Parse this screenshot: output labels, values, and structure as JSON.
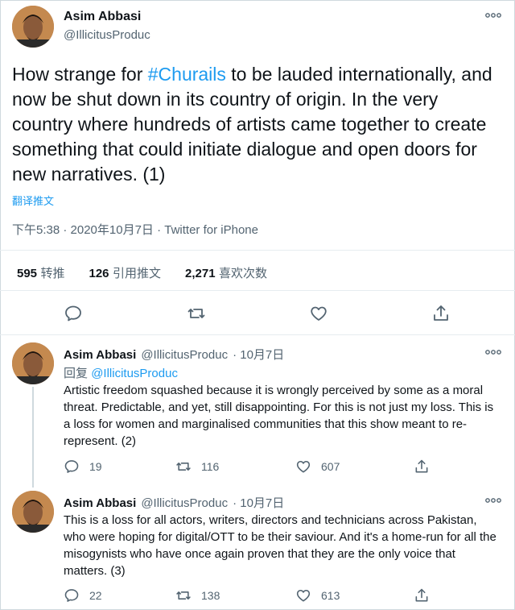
{
  "main_tweet": {
    "author_name": "Asim Abbasi",
    "author_handle": "@IllicitusProduc",
    "text_before_tag": "How strange for ",
    "hashtag": "#Churails",
    "text_after_tag": " to be lauded internationally, and now be shut down in its country of origin. In the very country where hundreds of artists came together to create something that could initiate dialogue and open doors for new narratives. (1)",
    "translate_label": "翻译推文",
    "timestamp": "下午5:38 · 2020年10月7日 · Twitter for iPhone",
    "stats": {
      "retweets_count": "595",
      "retweets_label": "转推",
      "quotes_count": "126",
      "quotes_label": "引用推文",
      "likes_count": "2,271",
      "likes_label": "喜欢次数"
    }
  },
  "replies": [
    {
      "author_name": "Asim Abbasi",
      "author_handle": "@IllicitusProduc",
      "date": "· 10月7日",
      "reply_prefix": "回复",
      "reply_to": "@IllicitusProduc",
      "text": "Artistic freedom squashed because it is wrongly perceived by some as a moral threat. Predictable, and yet, still disappointing. For this is not just my loss. This is a loss for women and marginalised communities that this show meant to re-represent. (2)",
      "replies_count": "19",
      "retweets_count": "116",
      "likes_count": "607"
    },
    {
      "author_name": "Asim Abbasi",
      "author_handle": "@IllicitusProduc",
      "date": "· 10月7日",
      "text": "This is a loss for all actors, writers, directors and technicians across Pakistan, who were hoping for digital/OTT to be their saviour. And it's a home-run for all the misogynists who have once again proven that they are the only voice that matters. (3)",
      "replies_count": "22",
      "retweets_count": "138",
      "likes_count": "613"
    }
  ],
  "icons": {
    "reply": "speech-bubble-icon",
    "retweet": "retweet-icon",
    "like": "heart-icon",
    "share": "share-icon",
    "more": "more-dots-icon"
  },
  "colors": {
    "accent": "#1d9bf0",
    "text": "#0f1419",
    "secondary": "#536471",
    "border": "#e6ecf0"
  }
}
